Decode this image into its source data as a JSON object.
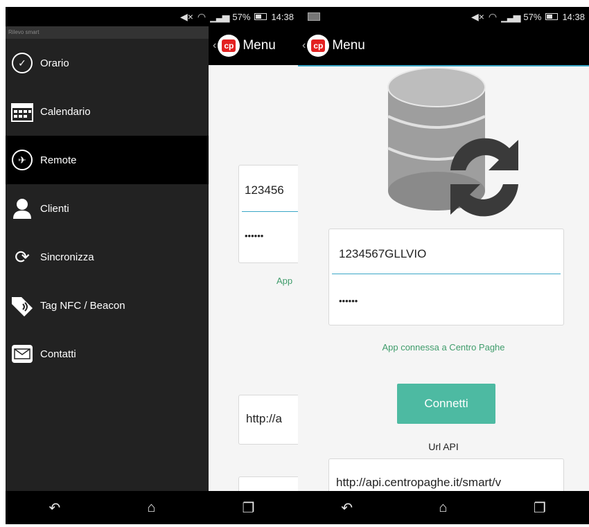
{
  "status_bar": {
    "battery": "57%",
    "time": "14:38"
  },
  "app_bar": {
    "title": "Menu",
    "logo_text": "cp"
  },
  "drawer": {
    "header": "Rilevo smart",
    "items": [
      {
        "label": "Orario",
        "icon": "clock-icon",
        "active": false
      },
      {
        "label": "Calendario",
        "icon": "calendar-icon",
        "active": false
      },
      {
        "label": "Remote",
        "icon": "globe-icon",
        "active": true
      },
      {
        "label": "Clienti",
        "icon": "person-icon",
        "active": false
      },
      {
        "label": "Sincronizza",
        "icon": "sync-icon",
        "active": false
      },
      {
        "label": "Tag NFC / Beacon",
        "icon": "nfc-tag-icon",
        "active": false
      },
      {
        "label": "Contatti",
        "icon": "mail-icon",
        "active": false
      }
    ]
  },
  "form": {
    "username_value": "1234567GLLVIO",
    "username_value_truncated": "123456",
    "password_value": "••••••",
    "status_note": "App connessa a Centro Paghe",
    "status_note_truncated": "App",
    "connect_label": "Connetti",
    "url_label": "Url API",
    "url_value": "http://api.centropaghe.it/smart/v",
    "url_value_truncated": "http://a"
  },
  "colors": {
    "accent": "#3aa7c7",
    "button": "#4dbaa2",
    "status_green": "#3f9c6b",
    "logo_red": "#e32121"
  }
}
